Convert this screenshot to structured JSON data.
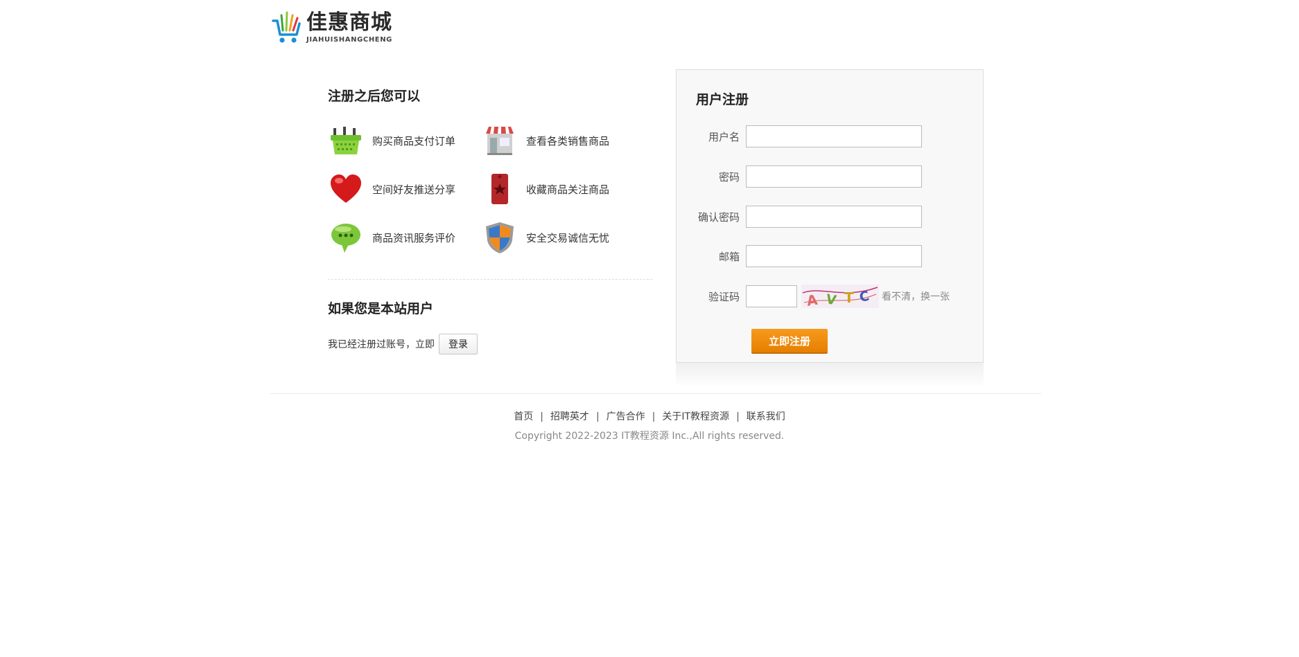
{
  "brand": {
    "name_cn": "佳惠商城",
    "name_en": "JIAHUISHANGCHENG",
    "logo_icon": "shopping-cart-logo-icon"
  },
  "benefits": {
    "title": "注册之后您可以",
    "items": [
      {
        "label": "购买商品支付订单",
        "icon": "basket-icon"
      },
      {
        "label": "查看各类销售商品",
        "icon": "store-icon"
      },
      {
        "label": "空间好友推送分享",
        "icon": "heart-icon"
      },
      {
        "label": "收藏商品关注商品",
        "icon": "bookmark-star-icon"
      },
      {
        "label": "商品资讯服务评价",
        "icon": "chat-bubble-icon"
      },
      {
        "label": "安全交易诚信无忧",
        "icon": "shield-icon"
      }
    ]
  },
  "existing_user": {
    "title": "如果您是本站用户",
    "text": "我已经注册过账号，立即",
    "login_label": "登录"
  },
  "register": {
    "title": "用户注册",
    "fields": {
      "username_label": "用户名",
      "password_label": "密码",
      "confirm_label": "确认密码",
      "email_label": "邮箱",
      "captcha_label": "验证码"
    },
    "captcha_text": "AVTC",
    "refresh_label": "看不清，换一张",
    "submit_label": "立即注册"
  },
  "footer": {
    "links": [
      "首页",
      "招聘英才",
      "广告合作",
      "关于IT教程资源",
      "联系我们"
    ],
    "separator": "|",
    "copyright": "Copyright 2022-2023 IT教程资源 Inc.,All rights reserved."
  },
  "colors": {
    "accent": "#F08A0B",
    "panel_bg": "#F8F8F8"
  }
}
